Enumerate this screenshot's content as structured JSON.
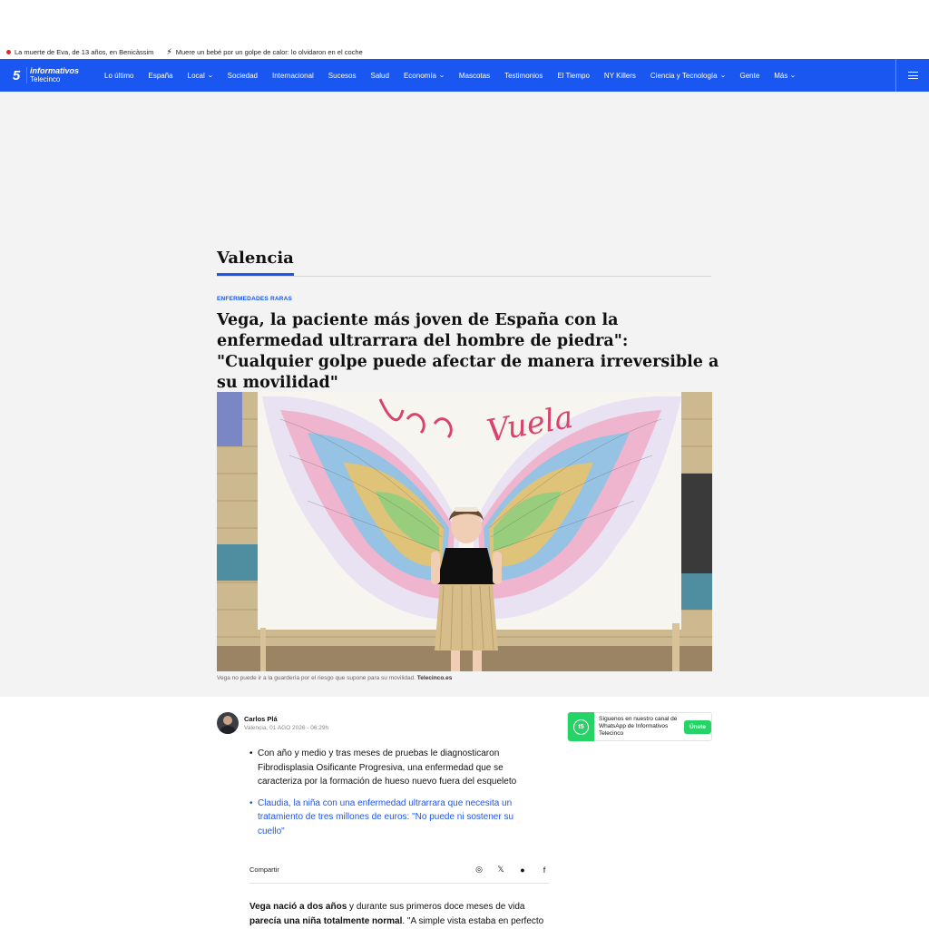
{
  "breaking": {
    "item1": "La muerte de Eva, de 13 años, en Benicàssim",
    "item2": "Muere un bebé por un golpe de calor: lo olvidaron en el coche"
  },
  "nav": {
    "logo_top": "informativos",
    "logo_bottom": "Telecinco",
    "items": [
      "Lo último",
      "España",
      "Local",
      "Sociedad",
      "Internacional",
      "Sucesos",
      "Salud",
      "Economía",
      "Mascotas",
      "Testimonios",
      "El Tiempo",
      "NY Killers",
      "Ciencia y Tecnología",
      "Gente",
      "Más"
    ]
  },
  "section": {
    "title": "Valencia"
  },
  "article": {
    "kicker": "ENFERMEDADES RARAS",
    "headline": "Vega, la paciente más joven de España con la enfermedad ultrarrara del hombre de piedra\": \"Cualquier golpe puede afectar de manera irreversible a su movilidad\"",
    "photo_text": "Vuela",
    "caption": "Vega no puede ir a la guardería por el riesgo que supone para su movilidad.",
    "caption_source": "Telecinco.es",
    "author_name": "Carlos Plá",
    "author_meta": "Valencia, 01 AGO 2026 - 06:29h",
    "bullet1": "Con año y medio y tras meses de pruebas le diagnosticaron Fibrodisplasia Osificante Progresiva, una enfermedad que se caracteriza por la formación de hueso nuevo fuera del esqueleto",
    "bullet2": "Claudia, la niña con una enfermedad ultrarrara que necesita un tratamiento de tres millones de euros: \"No puede ni sostener su cuello\"",
    "share_label": "Compartir",
    "body_b1": "Vega nació a dos años",
    "body_t1": " y durante sus primeros doce meses de vida ",
    "body_b2": "parecía una niña totalmente normal",
    "body_t2": ". \"A simple vista estaba en perfecto"
  },
  "whatsapp": {
    "text": "Síguenos en nuestro canal de WhatsApp de Informativos Telecinco",
    "join_label": "Únete"
  },
  "colors": {
    "brand_blue": "#1a56f0",
    "whatsapp_green": "#25d366",
    "alert_red": "#e3262a"
  }
}
